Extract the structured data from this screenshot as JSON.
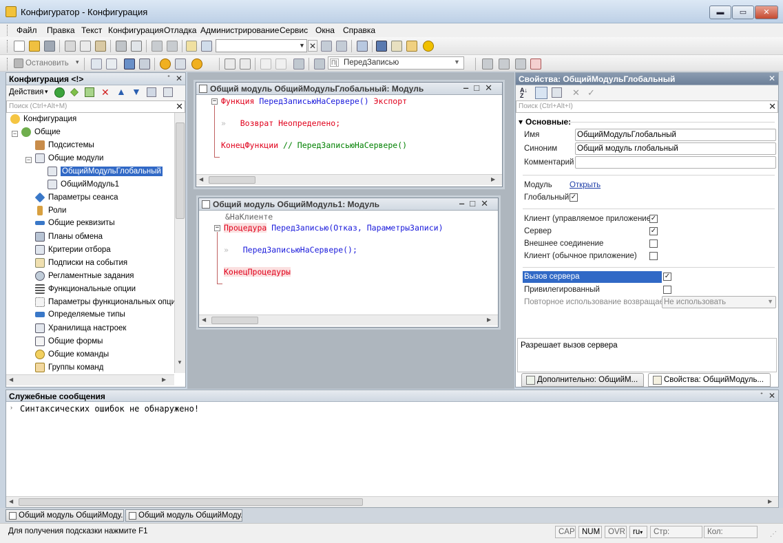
{
  "window": {
    "title": "Конфигуратор - Конфигурация",
    "min_glyph": "▬",
    "max_glyph": "▭",
    "close_glyph": "✕"
  },
  "menu": [
    "Файл",
    "Правка",
    "Текст",
    "Конфигурация",
    "Отладка",
    "Администрирование",
    "Сервис",
    "Окна",
    "Справка"
  ],
  "toolbar2": {
    "stop_label": "Остановить",
    "event_label": "ПередЗаписью",
    "event_badge": "П|"
  },
  "left_panel": {
    "title": "Конфигурация <!>",
    "actions_label": "Действия",
    "search_placeholder": "Поиск (Ctrl+Alt+M)",
    "tree": [
      {
        "label": "Конфигурация",
        "icon": "config-icon"
      },
      {
        "label": "Общие",
        "icon": "common-icon"
      },
      {
        "label": "Подсистемы",
        "icon": "subsystems-icon"
      },
      {
        "label": "Общие модули",
        "icon": "modules-icon"
      },
      {
        "label": "ОбщийМодульГлобальный",
        "icon": "module-icon"
      },
      {
        "label": "ОбщийМодуль1",
        "icon": "module-icon"
      },
      {
        "label": "Параметры сеанса",
        "icon": "session-params-icon"
      },
      {
        "label": "Роли",
        "icon": "roles-icon"
      },
      {
        "label": "Общие реквизиты",
        "icon": "attributes-icon"
      },
      {
        "label": "Планы обмена",
        "icon": "exchange-plans-icon"
      },
      {
        "label": "Критерии отбора",
        "icon": "filter-criteria-icon"
      },
      {
        "label": "Подписки на события",
        "icon": "event-subscriptions-icon"
      },
      {
        "label": "Регламентные задания",
        "icon": "scheduled-jobs-icon"
      },
      {
        "label": "Функциональные опции",
        "icon": "functional-options-icon"
      },
      {
        "label": "Параметры функциональных опций",
        "icon": "functional-params-icon"
      },
      {
        "label": "Определяемые типы",
        "icon": "defined-types-icon"
      },
      {
        "label": "Хранилища настроек",
        "icon": "settings-storage-icon"
      },
      {
        "label": "Общие формы",
        "icon": "forms-icon"
      },
      {
        "label": "Общие команды",
        "icon": "commands-icon"
      },
      {
        "label": "Группы команд",
        "icon": "command-groups-icon"
      }
    ]
  },
  "code1": {
    "title": "Общий модуль ОбщийМодульГлобальный: Модуль",
    "line1_kw": "Функция",
    "line1_name": "ПередЗаписьюНаСервере()",
    "line1_export": "Экспорт",
    "line2_mark": "»",
    "line2": "Возврат Неопределено;",
    "line3_kw": "КонецФункции",
    "line3_comment": "// ПередЗаписьюНаСервере()"
  },
  "code2": {
    "title": "Общий модуль ОбщийМодуль1: Модуль",
    "line0": "&НаКлиенте",
    "line1_kw": "Процедура",
    "line1_name": "ПередЗаписью(Отказ, ПараметрыЗаписи)",
    "line2_mark": "»",
    "line2": "ПередЗаписьюНаСервере();",
    "line3_kw": "КонецПроцедуры"
  },
  "properties": {
    "title": "Свойства: ОбщийМодульГлобальный",
    "search_placeholder": "Поиск (Ctrl+Alt+I)",
    "section": "Основные:",
    "name_label": "Имя",
    "name_value": "ОбщийМодульГлобальный",
    "synonym_label": "Синоним",
    "synonym_value": "Общий модуль глобальный",
    "comment_label": "Комментарий",
    "comment_value": "",
    "module_label": "Модуль",
    "module_link": "Открыть",
    "global_label": "Глобальный",
    "client_managed_label": "Клиент (управляемое приложение)",
    "server_label": "Сервер",
    "external_label": "Внешнее соединение",
    "client_ordinary_label": "Клиент (обычное приложение)",
    "server_call_label": "Вызов сервера",
    "privileged_label": "Привилегированный",
    "reuse_label": "Повторное использование возвращаем",
    "reuse_value": "Не использовать",
    "description": "Разрешает вызов сервера",
    "tab_additional": "Дополнительно: ОбщийМ...",
    "tab_properties": "Свойства: ОбщийМодуль..."
  },
  "messages": {
    "title": "Служебные сообщения",
    "text": "Синтаксических ошибок не обнаружено!"
  },
  "window_tabs": [
    "Общий модуль ОбщийМоду...",
    "Общий модуль ОбщийМоду..."
  ],
  "status": {
    "hint": "Для получения подсказки нажмите F1",
    "cap": "CAP",
    "num": "NUM",
    "ovr": "OVR",
    "lang": "ru",
    "line": "Стр:",
    "col": "Кол:"
  }
}
